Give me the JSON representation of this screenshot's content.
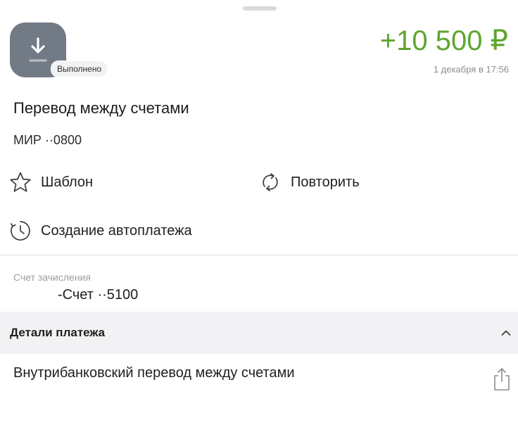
{
  "header": {
    "status_badge": "Выполнено",
    "amount": "+10 500 ₽",
    "datetime": "1 декабря в 17:56",
    "op_icon": "download-icon"
  },
  "operation": {
    "title": "Перевод между счетами",
    "card": "МИР ··0800"
  },
  "actions": {
    "template": {
      "label": "Шаблон",
      "icon": "star-icon"
    },
    "repeat": {
      "label": "Повторить",
      "icon": "repeat-icon"
    },
    "autopay": {
      "label": "Создание автоплатежа",
      "icon": "clock-icon"
    }
  },
  "account_field": {
    "caption": "Счет зачисления",
    "value": "-Счет ··5100"
  },
  "details": {
    "title": "Детали платежа",
    "text": "Внутрибанковский перевод между счетами",
    "share_icon": "share-icon"
  },
  "colors": {
    "amount": "#5fa52f",
    "icon_bg": "#727a86",
    "section_bg": "#f2f2f4"
  }
}
